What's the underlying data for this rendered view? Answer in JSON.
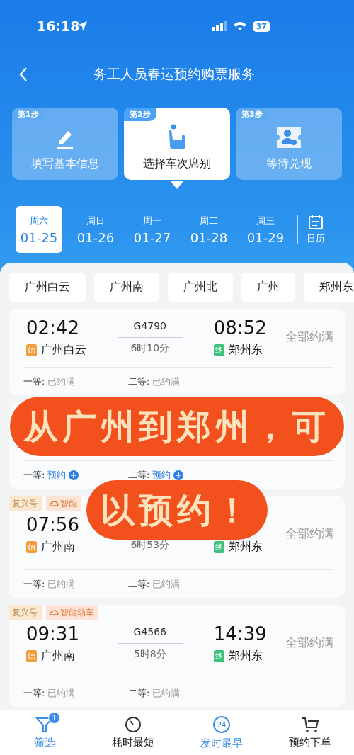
{
  "status_bar": {
    "time": "16:18",
    "battery": "37"
  },
  "header": {
    "title": "务工人员春运预约购票服务"
  },
  "steps": [
    {
      "badge": "第1步",
      "label": "填写基本信息",
      "kind": "pencil",
      "selected": false
    },
    {
      "badge": "第2步",
      "label": "选择车次席别",
      "kind": "seat",
      "selected": true
    },
    {
      "badge": "第3步",
      "label": "等待兑现",
      "kind": "ticket",
      "selected": false
    }
  ],
  "dates": [
    {
      "weekday": "周六",
      "date": "01-25",
      "selected": true
    },
    {
      "weekday": "周日",
      "date": "01-26",
      "selected": false
    },
    {
      "weekday": "周一",
      "date": "01-27",
      "selected": false
    },
    {
      "weekday": "周二",
      "date": "01-28",
      "selected": false
    },
    {
      "weekday": "周三",
      "date": "01-29",
      "selected": false
    }
  ],
  "calendar": {
    "label": "日历"
  },
  "stations": [
    "广州白云",
    "广州南",
    "广州北",
    "广州",
    "郑州东"
  ],
  "trains": [
    {
      "depart_time": "02:42",
      "train_no": "G4790",
      "arrive_time": "08:52",
      "from_mark": "始",
      "from_station": "广州白云",
      "duration": "6时10分",
      "to_mark": "终",
      "to_station": "郑州东",
      "status": "全部约满",
      "seats": [
        {
          "label": "一等:",
          "value": "已约满",
          "available": false
        },
        {
          "label": "二等:",
          "value": "已约满",
          "available": false
        }
      ]
    },
    {
      "seats": [
        {
          "label": "一等:",
          "value": "预约",
          "available": true
        },
        {
          "label": "二等:",
          "value": "预约",
          "available": true
        }
      ]
    },
    {
      "tags": [
        {
          "text": "复兴号",
          "kind": "plain"
        },
        {
          "text": "智能",
          "kind": "smart"
        }
      ],
      "depart_time": "07:56",
      "from_mark": "始",
      "from_station": "广州南",
      "duration": "6时53分",
      "to_mark": "终",
      "to_station": "郑州东",
      "status": "全部约满",
      "seats": [
        {
          "label": "一等:",
          "value": "已约满",
          "available": false
        },
        {
          "label": "二等:",
          "value": "已约满",
          "available": false
        }
      ]
    },
    {
      "tags": [
        {
          "text": "复兴号",
          "kind": "plain"
        },
        {
          "text": "智能动车",
          "kind": "smart"
        }
      ],
      "depart_time": "09:31",
      "train_no": "G4566",
      "arrive_time": "14:39",
      "from_mark": "始",
      "from_station": "广州南",
      "duration": "5时8分",
      "to_mark": "终",
      "to_station": "郑州东",
      "status": "全部约满",
      "seats": [
        {
          "label": "一等:",
          "value": "已约满",
          "available": false
        },
        {
          "label": "二等:",
          "value": "已约满",
          "available": false
        }
      ]
    }
  ],
  "bottom_nav": [
    {
      "label": "筛选",
      "kind": "filter",
      "selected": true,
      "badge": "1"
    },
    {
      "label": "耗时最短",
      "kind": "timer",
      "selected": false
    },
    {
      "label": "发时最早",
      "kind": "clock24",
      "selected": true,
      "icon_text": "24"
    },
    {
      "label": "预约下单",
      "kind": "cart",
      "selected": false
    }
  ],
  "overlay": {
    "lines": [
      "从广州到郑州，可",
      "以预约！"
    ]
  }
}
